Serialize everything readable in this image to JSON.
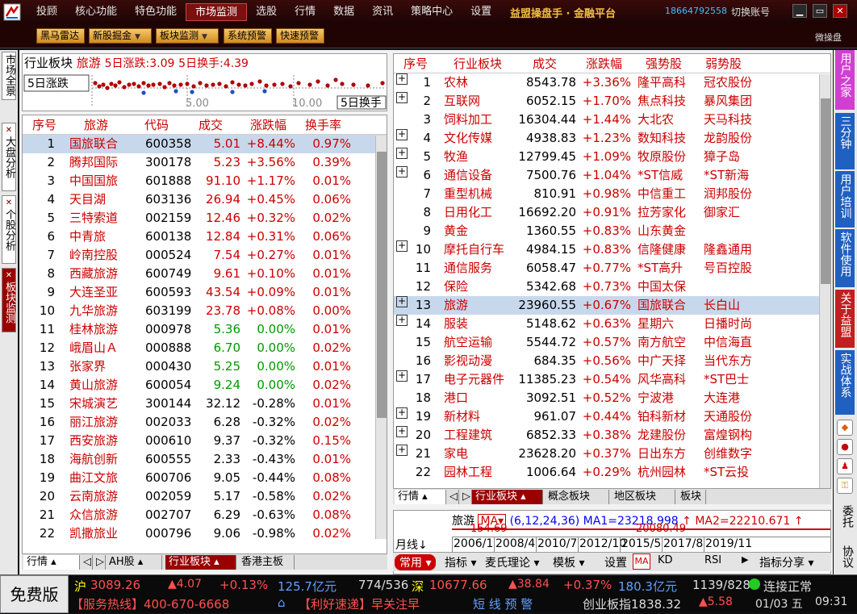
{
  "menu": {
    "items": [
      "投顾",
      "核心功能",
      "特色功能",
      "市场监测",
      "选股",
      "行情",
      "数据",
      "资讯",
      "策略中心",
      "设置"
    ],
    "brand": "益盟操盘手 · 金融平台",
    "phone": "18664792558",
    "switch": "切换账号"
  },
  "toolbar": {
    "buttons": [
      "黑马雷达",
      "新股掘金",
      "板块监测",
      "系统预警",
      "快速预警"
    ],
    "weipan": "微操盘"
  },
  "left_tabs": [
    "市场全景",
    "大盘分析",
    "个股分析",
    "板块监测"
  ],
  "right_tabs": [
    "用户之家",
    "三分钟",
    "用户培训",
    "软件使用",
    "关于益盟",
    "实战体系"
  ],
  "right_icons": [
    "委托",
    "协议"
  ],
  "summary": {
    "label": "行业板块",
    "name": "旅游",
    "change": "5日涨跌:3.09",
    "turnover": "5日换手:4.39",
    "y_label": "5日涨跌",
    "x_ticks": [
      "5.00",
      "10.00"
    ],
    "x_label": "5日换手"
  },
  "left_table": {
    "headers": [
      "序号",
      "旅游",
      "代码",
      "成交",
      "涨跌幅",
      "换手率"
    ],
    "rows": [
      [
        "1",
        "国旅联合",
        "600358",
        "5.01",
        "+8.44%",
        "0.97%"
      ],
      [
        "2",
        "腾邦国际",
        "300178",
        "5.23",
        "+3.56%",
        "0.39%"
      ],
      [
        "3",
        "中国国旅",
        "601888",
        "91.10",
        "+1.17%",
        "0.01%"
      ],
      [
        "4",
        "天目湖",
        "603136",
        "26.94",
        "+0.45%",
        "0.06%"
      ],
      [
        "5",
        "三特索道",
        "002159",
        "12.46",
        "+0.32%",
        "0.02%"
      ],
      [
        "6",
        "中青旅",
        "600138",
        "12.84",
        "+0.31%",
        "0.06%"
      ],
      [
        "7",
        "岭南控股",
        "000524",
        "7.54",
        "+0.27%",
        "0.01%"
      ],
      [
        "8",
        "西藏旅游",
        "600749",
        "9.61",
        "+0.10%",
        "0.01%"
      ],
      [
        "9",
        "大连圣亚",
        "600593",
        "43.54",
        "+0.09%",
        "0.01%"
      ],
      [
        "10",
        "九华旅游",
        "603199",
        "23.78",
        "+0.08%",
        "0.00%"
      ],
      [
        "11",
        "桂林旅游",
        "000978",
        "5.36",
        "0.00%",
        "0.01%"
      ],
      [
        "12",
        "峨眉山Ａ",
        "000888",
        "6.70",
        "0.00%",
        "0.02%"
      ],
      [
        "13",
        "张家界",
        "000430",
        "5.25",
        "0.00%",
        "0.01%"
      ],
      [
        "14",
        "黄山旅游",
        "600054",
        "9.24",
        "0.00%",
        "0.02%"
      ],
      [
        "15",
        "宋城演艺",
        "300144",
        "32.12",
        "-0.28%",
        "0.01%"
      ],
      [
        "16",
        "丽江旅游",
        "002033",
        "6.28",
        "-0.32%",
        "0.02%"
      ],
      [
        "17",
        "西安旅游",
        "000610",
        "9.37",
        "-0.32%",
        "0.15%"
      ],
      [
        "18",
        "海航创新",
        "600555",
        "2.33",
        "-0.43%",
        "0.01%"
      ],
      [
        "19",
        "曲江文旅",
        "600706",
        "9.05",
        "-0.44%",
        "0.08%"
      ],
      [
        "20",
        "云南旅游",
        "002059",
        "5.17",
        "-0.58%",
        "0.02%"
      ],
      [
        "21",
        "众信旅游",
        "002707",
        "6.29",
        "-0.63%",
        "0.08%"
      ],
      [
        "22",
        "凯撒旅业",
        "000796",
        "9.06",
        "-0.98%",
        "0.02%"
      ]
    ]
  },
  "left_tabbar": [
    "行情",
    "AH股",
    "行业板块",
    "香港主板"
  ],
  "right_table": {
    "headers": [
      "序号",
      "行业板块",
      "成交",
      "涨跌幅",
      "强势股",
      "弱势股"
    ],
    "rows": [
      [
        "1",
        "农林",
        "8543.78",
        "+3.36%",
        "隆平高科",
        "冠农股份"
      ],
      [
        "2",
        "互联网",
        "6052.15",
        "+1.70%",
        "焦点科技",
        "暴风集团"
      ],
      [
        "3",
        "饲料加工",
        "16304.44",
        "+1.44%",
        "大北农",
        "天马科技"
      ],
      [
        "4",
        "文化传媒",
        "4938.83",
        "+1.23%",
        "数知科技",
        "龙韵股份"
      ],
      [
        "5",
        "牧渔",
        "12799.45",
        "+1.09%",
        "牧原股份",
        "獐子岛"
      ],
      [
        "6",
        "通信设备",
        "7500.76",
        "+1.04%",
        "*ST信威",
        "*ST新海"
      ],
      [
        "7",
        "重型机械",
        "810.91",
        "+0.98%",
        "中信重工",
        "润邦股份"
      ],
      [
        "8",
        "日用化工",
        "16692.20",
        "+0.91%",
        "拉芳家化",
        "御家汇"
      ],
      [
        "9",
        "黄金",
        "1360.55",
        "+0.83%",
        "山东黄金",
        ""
      ],
      [
        "10",
        "摩托自行车",
        "4984.15",
        "+0.83%",
        "信隆健康",
        "隆鑫通用"
      ],
      [
        "11",
        "通信服务",
        "6058.47",
        "+0.77%",
        "*ST高升",
        "号百控股"
      ],
      [
        "12",
        "保险",
        "5342.68",
        "+0.73%",
        "中国太保",
        ""
      ],
      [
        "13",
        "旅游",
        "23960.55",
        "+0.67%",
        "国旅联合",
        "长白山"
      ],
      [
        "14",
        "服装",
        "5148.62",
        "+0.63%",
        "星期六",
        "日播时尚"
      ],
      [
        "15",
        "航空运输",
        "5544.72",
        "+0.57%",
        "南方航空",
        "中信海直"
      ],
      [
        "16",
        "影视动漫",
        "684.35",
        "+0.56%",
        "中广天择",
        "当代东方"
      ],
      [
        "17",
        "电子元器件",
        "11385.23",
        "+0.54%",
        "风华高科",
        "*ST巴士"
      ],
      [
        "18",
        "港口",
        "3092.51",
        "+0.52%",
        "宁波港",
        "大连港"
      ],
      [
        "19",
        "新材料",
        "961.07",
        "+0.44%",
        "铂科新材",
        "天通股份"
      ],
      [
        "20",
        "工程建筑",
        "6852.33",
        "+0.38%",
        "龙建股份",
        "富煌钢构"
      ],
      [
        "21",
        "家电",
        "23628.20",
        "+0.37%",
        "日出东方",
        "创维数字"
      ],
      [
        "22",
        "园林工程",
        "1006.64",
        "+0.29%",
        "杭州园林",
        "*ST云投"
      ]
    ]
  },
  "right_tabbar": [
    "行情",
    "行业板块",
    "概念板块",
    "地区板块",
    "板块"
  ],
  "kline": {
    "name": "旅游",
    "indicator": "MA",
    "params": "(6,12,24,36)",
    "ma1": "MA1=23218.998",
    "ma2": "MA2=22210.671",
    "price1": "154.69",
    "price2": "20080.49",
    "period": "月线",
    "dates": [
      "2006/1",
      "2008/4",
      "2010/7",
      "2012/10",
      "2015/5",
      "2017/8",
      "2019/11"
    ]
  },
  "kline_toolbar": [
    "常用",
    "指标",
    "麦氏理论",
    "模板",
    "设置",
    "MA",
    "KD",
    "RSI",
    "指标分享"
  ],
  "status": {
    "free": "免费版",
    "sh_label": "沪",
    "sh_idx": "3089.26",
    "sh_chg": "▲4.07",
    "sh_pct": "+0.13%",
    "sh_amt": "125.7亿元",
    "sh_updown": "774/536",
    "sz_label": "深",
    "sz_idx": "10677.66",
    "sz_chg": "▲38.84",
    "sz_pct": "+0.37%",
    "sz_amt": "180.3亿元",
    "sz_updown": "1139/828",
    "conn": "连接正常",
    "hotline": "【服务热线】400-670-6668",
    "news": "【利好速递】早关注早",
    "alert": "短 线 预 警",
    "cyb": "创业板指1838.32",
    "cyb_chg": "▲5.58",
    "date": "01/03 五",
    "time": "09:31"
  },
  "colors": {
    "up": "#cc0000",
    "down": "#009900",
    "accent": "#990000"
  }
}
